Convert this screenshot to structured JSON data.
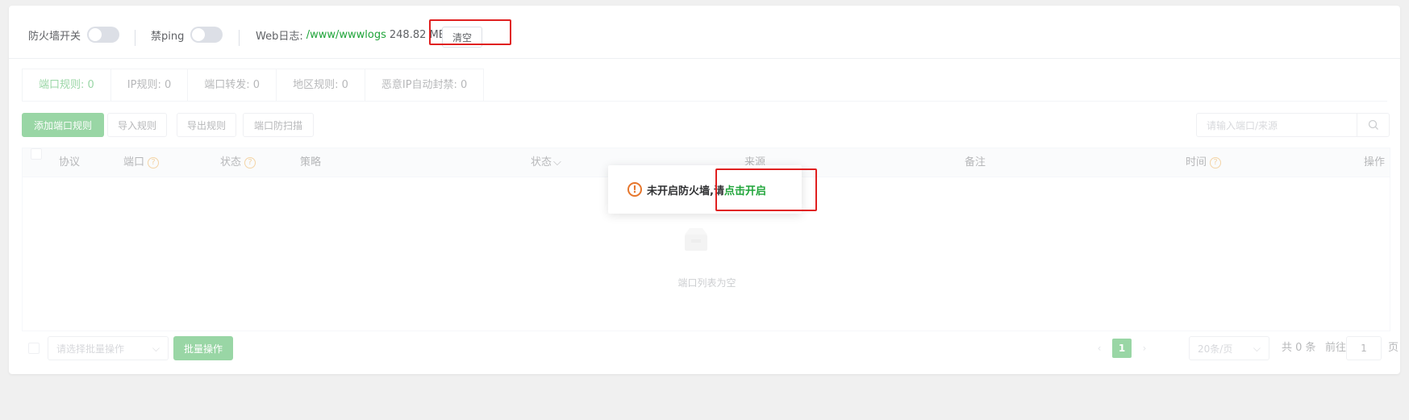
{
  "topbar": {
    "firewall_label": "防火墙开关",
    "ping_label": "禁ping",
    "weblog_label": "Web日志:",
    "weblog_path": "/www/wwwlogs",
    "weblog_size": "248.82 MB",
    "clear_button": "清空"
  },
  "tabs": [
    {
      "label": "端口规则: 0",
      "active": true
    },
    {
      "label": "IP规则: 0"
    },
    {
      "label": "端口转发: 0"
    },
    {
      "label": "地区规则: 0"
    },
    {
      "label": "恶意IP自动封禁: 0"
    }
  ],
  "toolbar": {
    "add_rule": "添加端口规则",
    "import_rule": "导入规则",
    "export_rule": "导出规则",
    "port_scan": "端口防扫描",
    "search_placeholder": "请输入端口/来源"
  },
  "table": {
    "columns": {
      "protocol": "协议",
      "port": "端口",
      "status": "状态",
      "strategy": "策略",
      "status2": "状态",
      "source": "来源",
      "remark": "备注",
      "time": "时间",
      "actions": "操作"
    },
    "empty_text": "端口列表为空"
  },
  "footer": {
    "batch_placeholder": "请选择批量操作",
    "batch_button": "批量操作",
    "current_page": "1",
    "page_size": "20条/页",
    "total": "共 0 条",
    "goto_label": "前往",
    "goto_value": "1",
    "page_suffix": "页"
  },
  "popup": {
    "message": "未开启防火墙,请",
    "link": "点击开启"
  },
  "colors": {
    "accent": "#20a53a",
    "highlight_box": "#e02020",
    "warning": "#e6762c"
  }
}
